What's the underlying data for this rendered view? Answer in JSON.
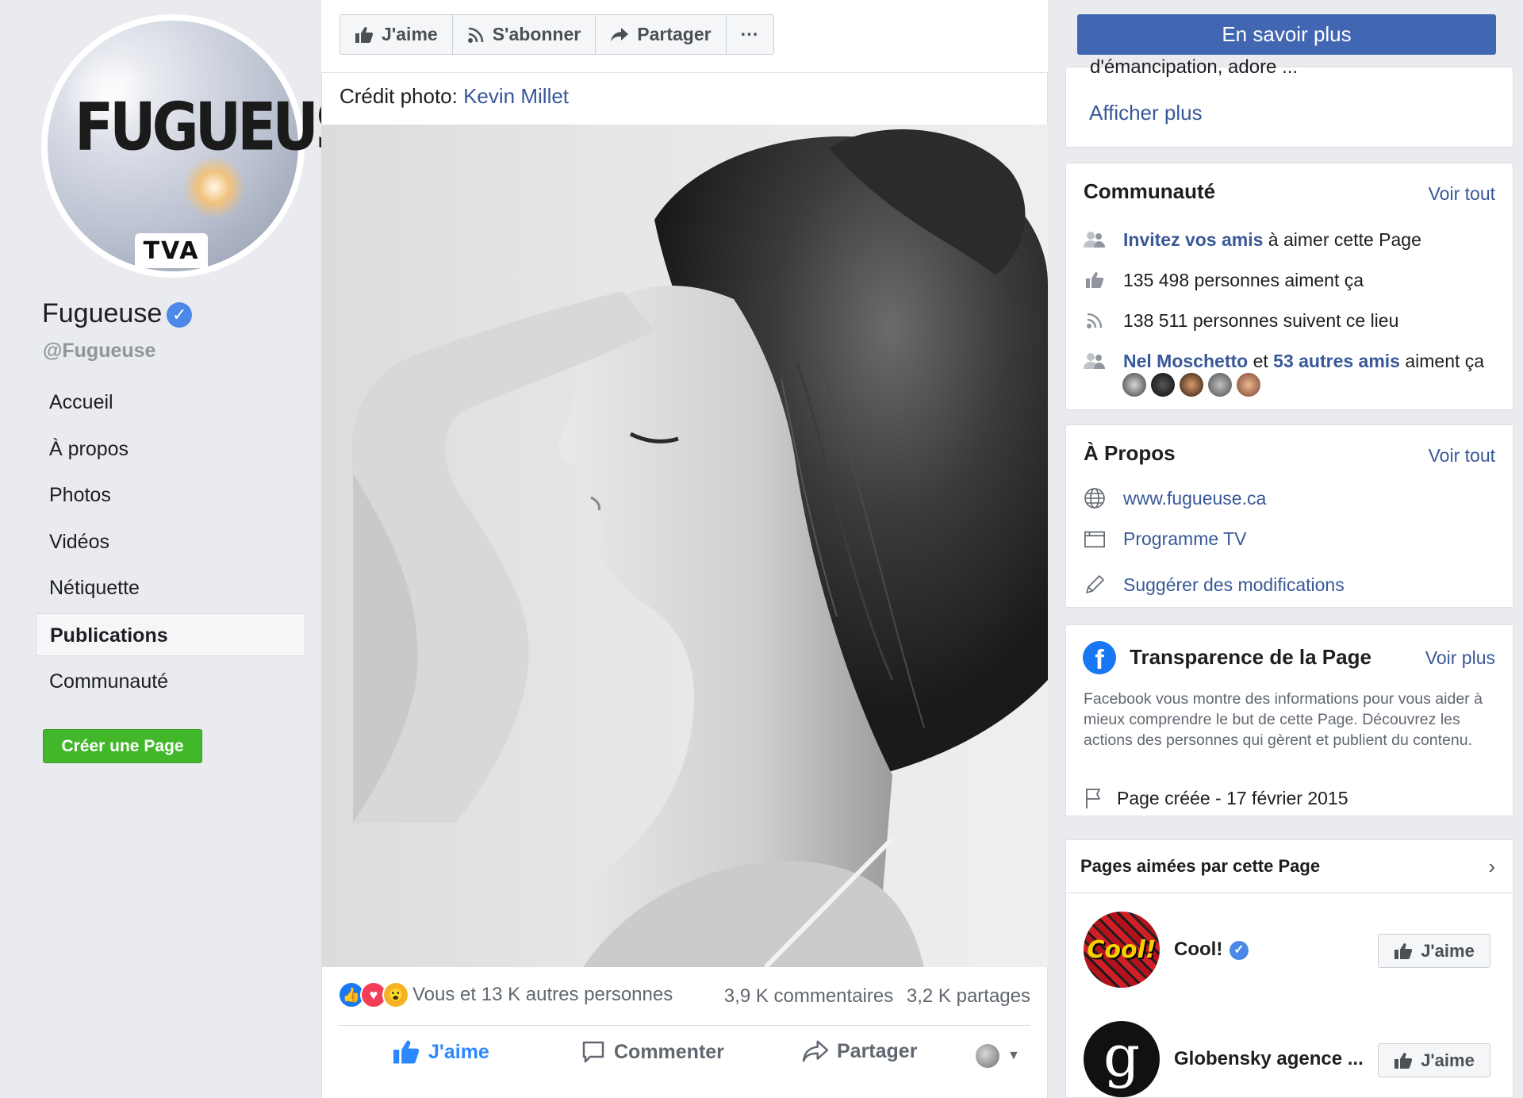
{
  "colors": {
    "facebook_blue": "#4267b2",
    "link": "#385898",
    "green": "#42b72a",
    "verified": "#4b88e7",
    "like_blue": "#2d88ff"
  },
  "profile": {
    "avatar_logo": "FUGUEUSE",
    "avatar_network": "TVA",
    "name": "Fugueuse",
    "handle": "@Fugueuse"
  },
  "nav": {
    "items": [
      "Accueil",
      "À propos",
      "Photos",
      "Vidéos",
      "Nétiquette",
      "Publications",
      "Communauté"
    ],
    "active": "Publications",
    "create_page": "Créer une Page"
  },
  "page_actions": {
    "like": "J'aime",
    "subscribe": "S'abonner",
    "share": "Partager",
    "more": "···"
  },
  "cta": "En savoir plus",
  "post": {
    "credit_prefix": "Crédit photo: ",
    "credit_name": "Kevin Millet",
    "reactions_text": "Vous et 13 K autres personnes",
    "comments": "3,9 K commentaires",
    "shares": "3,2 K partages",
    "actions": {
      "like": "J'aime",
      "comment": "Commenter",
      "share": "Partager"
    }
  },
  "about_top": {
    "clipped_text": "d'émancipation, adore ...",
    "show_more": "Afficher plus"
  },
  "community": {
    "title": "Communauté",
    "see_all": "Voir tout",
    "invite_link": "Invitez vos amis",
    "invite_rest": " à aimer cette Page",
    "likes": "135 498 personnes aiment ça",
    "follows": "138 511 personnes suivent ce lieu",
    "friend_name": "Nel Moschetto",
    "friends_and": " et ",
    "friends_more": "53 autres amis",
    "friends_rest": " aiment ça"
  },
  "about": {
    "title": "À Propos",
    "see_all": "Voir tout",
    "website": "www.fugueuse.ca",
    "tv": "Programme TV",
    "suggest": "Suggérer des modifications"
  },
  "transparency": {
    "title": "Transparence de la Page",
    "see_more": "Voir plus",
    "description": "Facebook vous montre des informations pour vous aider à mieux comprendre le but de cette Page. Découvrez les actions des personnes qui gèrent et publient du contenu.",
    "created": "Page créée - 17 février 2015"
  },
  "liked_pages": {
    "header": "Pages aimées par cette Page",
    "items": [
      {
        "name": "Cool!",
        "logo_text": "Cool!",
        "button": "J'aime"
      },
      {
        "name": "Globensky agence ...",
        "logo_text": "g",
        "button": "J'aime"
      }
    ]
  }
}
